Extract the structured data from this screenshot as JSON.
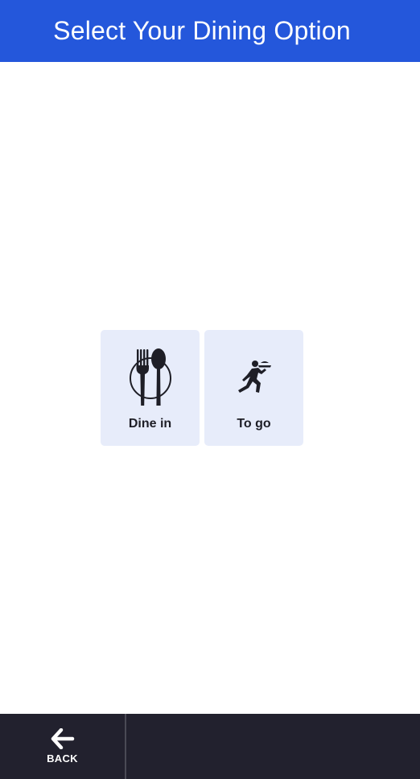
{
  "header": {
    "title": "Select Your Dining Option"
  },
  "options": [
    {
      "label": "Dine in",
      "icon": "fork-spoon-plate-icon"
    },
    {
      "label": "To go",
      "icon": "running-waiter-icon"
    }
  ],
  "footer": {
    "back_label": "BACK",
    "back_icon": "arrow-left-icon"
  },
  "colors": {
    "header_bg": "#2457db",
    "card_bg": "#e7ecfa",
    "footer_bg": "#22212e",
    "icon_fill": "#1e1e26"
  }
}
